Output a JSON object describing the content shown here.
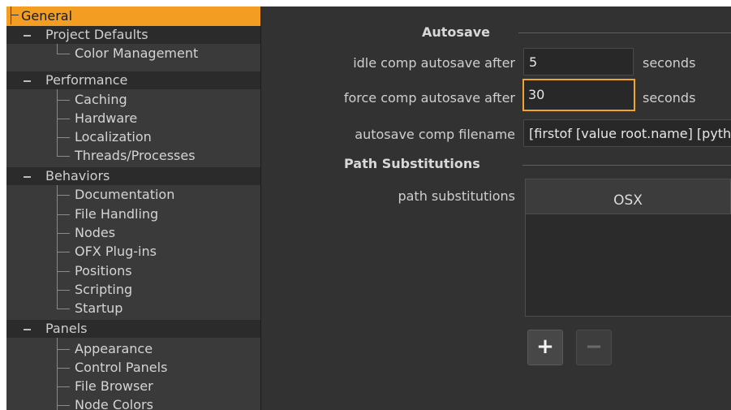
{
  "sidebar": {
    "selected": "General",
    "categories": [
      {
        "label": "General"
      },
      {
        "label": "Project Defaults",
        "items": [
          "Color Management"
        ]
      },
      {
        "label": "Performance",
        "items": [
          "Caching",
          "Hardware",
          "Localization",
          "Threads/Processes"
        ]
      },
      {
        "label": "Behaviors",
        "items": [
          "Documentation",
          "File Handling",
          "Nodes",
          "OFX Plug-ins",
          "Positions",
          "Scripting",
          "Startup"
        ]
      },
      {
        "label": "Panels",
        "items": [
          "Appearance",
          "Control Panels",
          "File Browser",
          "Node Colors"
        ]
      }
    ]
  },
  "autosave": {
    "title": "Autosave",
    "idle_label": "idle comp autosave after",
    "idle_value": "5",
    "idle_unit": "seconds",
    "force_label": "force comp autosave after",
    "force_value": "30",
    "force_unit": "seconds",
    "filename_label": "autosave comp filename",
    "filename_value": "[firstof [value root.name] [python nuke.script_directory()]]"
  },
  "path_substitutions": {
    "title": "Path Substitutions",
    "label": "path substitutions",
    "columns": [
      "OSX"
    ],
    "add_label": "+",
    "remove_label": "−"
  },
  "colors": {
    "selected": "#f49d23",
    "focus_border": "#f2a52a",
    "panel_bg": "#323232"
  }
}
